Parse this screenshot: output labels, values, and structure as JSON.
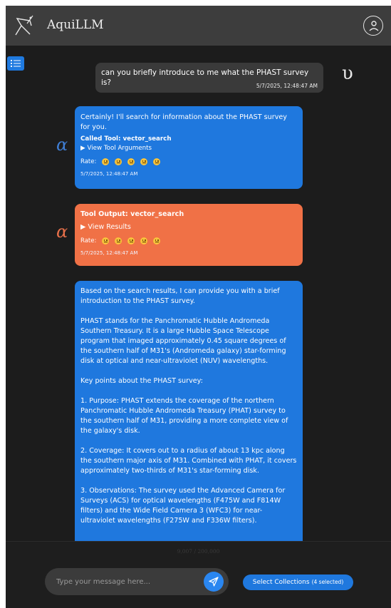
{
  "header": {
    "app_title": "AquiLLM",
    "logo_icon": "telescope-logo-icon",
    "profile_icon": "user-profile-icon"
  },
  "sidebar_toggle": {
    "icon": "list-icon"
  },
  "messages": [
    {
      "role": "user",
      "avatar": "υ",
      "text": "can you briefly introduce to me what the PHAST survey is?",
      "timestamp": "5/7/2025, 12:48:47 AM"
    },
    {
      "role": "assistant",
      "avatar": "α",
      "text": "Certainly! I'll search for information about the PHAST survey for you.",
      "tool_called": "Called Tool: vector_search",
      "expander": "▶ View Tool Arguments",
      "rate_label": "Rate:",
      "timestamp": "5/7/2025, 12:48:47 AM"
    },
    {
      "role": "tool",
      "avatar": "α",
      "title": "Tool Output: vector_search",
      "expander": "▶ View Results",
      "rate_label": "Rate:",
      "timestamp": "5/7/2025, 12:48:47 AM"
    },
    {
      "role": "assistant",
      "text": "Based on the search results, I can provide you with a brief introduction to the PHAST survey.\n\nPHAST stands for the Panchromatic Hubble Andromeda Southern Treasury. It is a large Hubble Space Telescope program that imaged approximately 0.45 square degrees of the southern half of M31's (Andromeda galaxy) star-forming disk at optical and near-ultraviolet (NUV) wavelengths.\n\nKey points about the PHAST survey:\n\n1. Purpose: PHAST extends the coverage of the northern Panchromatic Hubble Andromeda Treasury (PHAT) survey to the southern half of M31, providing a more complete view of the galaxy's disk.\n\n2. Coverage: It covers out to a radius of about 13 kpc along the southern major axis of M31. Combined with PHAT, it covers approximately two-thirds of M31's star-forming disk.\n\n3. Observations: The survey used the Advanced Camera for Surveys (ACS) for optical wavelengths (F475W and F814W filters) and the Wide Field Camera 3 (WFC3) for near-ultraviolet wavelengths (F275W and F336W filters)."
    }
  ],
  "rating_emojis": [
    "frowning-face-icon",
    "slightly-frowning-face-icon",
    "neutral-face-icon",
    "slightly-smiling-face-icon",
    "smiling-face-icon"
  ],
  "footer": {
    "token_count": "9,007 / 200,000",
    "input_placeholder": "Type your message here...",
    "send_icon": "send-icon",
    "collections_label": "Select Collections",
    "collections_count": "(4 selected)"
  },
  "colors": {
    "background": "#1c1c1c",
    "header": "#3d3d3d",
    "assistant_bubble": "#1f78de",
    "tool_bubble": "#f07146",
    "user_bubble": "#3a3a3a"
  }
}
